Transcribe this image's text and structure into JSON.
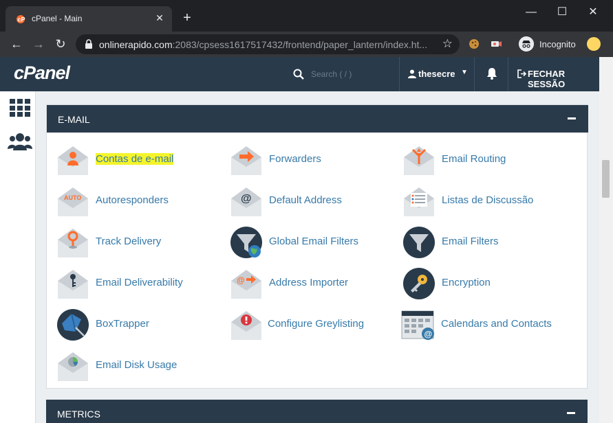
{
  "browser": {
    "tab_title": "cPanel - Main",
    "tab_close": "✕",
    "new_tab": "+",
    "url_host": "onlinerapido.com",
    "url_rest": ":2083/cpsess1617517432/frontend/paper_lantern/index.ht...",
    "incognito_label": "Incognito",
    "window_minimize": "—",
    "window_maximize": "☐",
    "window_close": "✕"
  },
  "header": {
    "logo": "cPanel",
    "search_placeholder": "Search ( / )",
    "username": "thesecre",
    "logout_label": "FECHAR SESSÃO"
  },
  "email_section": {
    "title": "E-MAIL",
    "items": [
      {
        "label": "Contas de e-mail",
        "icon": "email-accounts-icon"
      },
      {
        "label": "Forwarders",
        "icon": "forwarders-icon"
      },
      {
        "label": "Email Routing",
        "icon": "email-routing-icon"
      },
      {
        "label": "Autoresponders",
        "icon": "autoresponders-icon"
      },
      {
        "label": "Default Address",
        "icon": "default-address-icon"
      },
      {
        "label": "Listas de Discussão",
        "icon": "mailing-lists-icon"
      },
      {
        "label": "Track Delivery",
        "icon": "track-delivery-icon"
      },
      {
        "label": "Global Email Filters",
        "icon": "global-filters-icon"
      },
      {
        "label": "Email Filters",
        "icon": "email-filters-icon"
      },
      {
        "label": "Email Deliverability",
        "icon": "deliverability-icon"
      },
      {
        "label": "Address Importer",
        "icon": "address-importer-icon"
      },
      {
        "label": "Encryption",
        "icon": "encryption-icon"
      },
      {
        "label": "BoxTrapper",
        "icon": "boxtrapper-icon"
      },
      {
        "label": "Configure Greylisting",
        "icon": "greylisting-icon"
      },
      {
        "label": "Calendars and Contacts",
        "icon": "calendars-icon"
      },
      {
        "label": "Email Disk Usage",
        "icon": "disk-usage-icon"
      }
    ],
    "autoresponder_badge": "AUTO"
  },
  "metrics_section": {
    "title": "METRICS"
  },
  "colors": {
    "header_bg": "#293a4a",
    "link": "#377aa9",
    "highlight": "#f4f42a"
  }
}
